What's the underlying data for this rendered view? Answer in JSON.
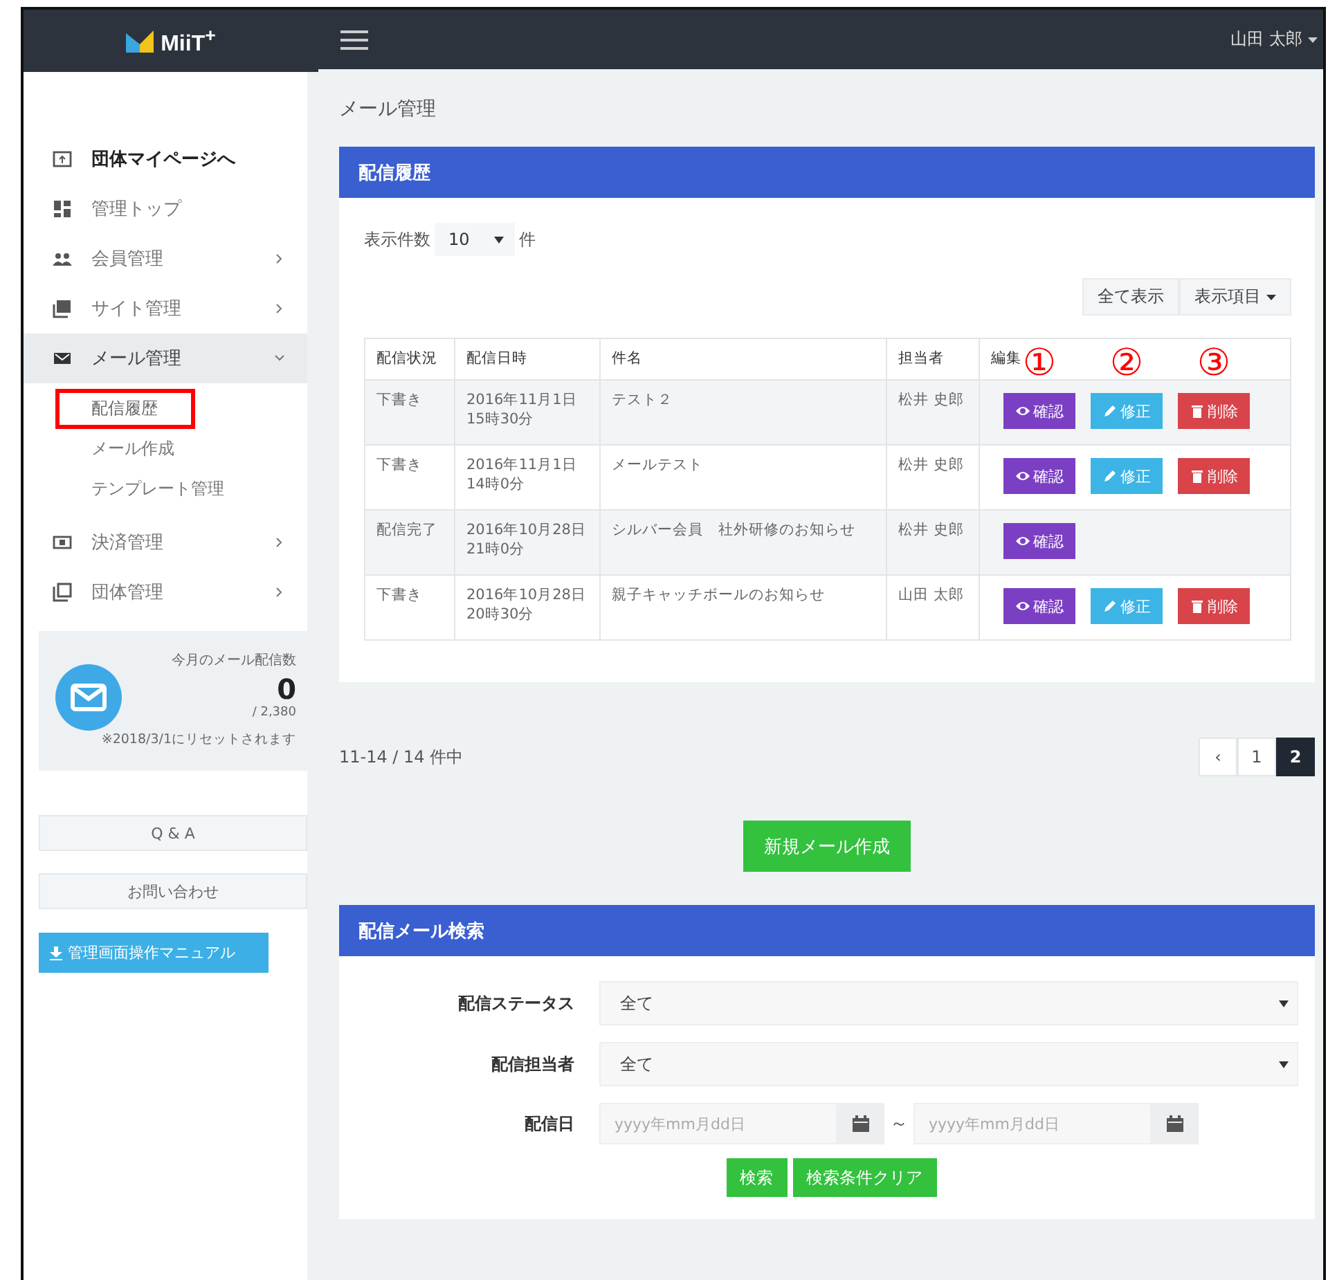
{
  "sidebar": {
    "logo": "MiiT$^{+}$",
    "nav": [
      {
        "label": "団体マイページへ",
        "kind": "external",
        "selected": false
      },
      {
        "label": "管理トップ",
        "kind": "menu",
        "selected": false
      },
      {
        "label": "会員管理",
        "kind": "menu",
        "selected": false,
        "expanded": false
      },
      {
        "label": "サイト管理",
        "kind": "menu",
        "selected": false,
        "expanded": false
      },
      {
        "label": "メール管理",
        "kind": "menu",
        "selected": true,
        "expanded": true,
        "children": [
          {
            "label": "配信履歴",
            "highlighted": true
          },
          {
            "label": "メール作成",
            "highlighted": false
          },
          {
            "label": "テンプレート管理",
            "highlighted": false
          }
        ]
      },
      {
        "label": "決済管理",
        "kind": "menu",
        "selected": false,
        "expanded": false
      },
      {
        "label": "団体管理",
        "kind": "menu",
        "selected": false,
        "expanded": false
      }
    ],
    "stats": {
      "title": "今月のメール配信数",
      "count": "0",
      "limit": "/ 2,380",
      "note": "※2018/3/1にリセットされます"
    },
    "links": [
      "Q & A",
      "お問い合わせ"
    ],
    "manual_button": "管理画面操作マニュアル"
  },
  "topbar": {
    "user": "山田 太郎"
  },
  "page_title": "メール管理",
  "history_panel": {
    "title": "配信履歴",
    "per_page_label": "表示件数",
    "per_page": "10",
    "per_page_unit": "件",
    "tools": [
      "全て表示",
      "表示項目"
    ],
    "columns": [
      "配信状況",
      "配信日時",
      "件名",
      "担当者",
      "編集"
    ],
    "annotations": [
      "①",
      "②",
      "③"
    ],
    "rows": [
      {
        "status": "下書き",
        "date": [
          "2016年11月1日",
          "15時30分"
        ],
        "subject": "テスト２",
        "person": "松井 史郎",
        "actions": [
          {
            "kind": "view",
            "label": "確認"
          },
          {
            "kind": "edit",
            "label": "修正"
          },
          {
            "kind": "delete",
            "label": "削除"
          }
        ]
      },
      {
        "status": "下書き",
        "date": [
          "2016年11月1日",
          "14時0分"
        ],
        "subject": "メールテスト",
        "person": "松井 史郎",
        "actions": [
          {
            "kind": "view",
            "label": "確認"
          },
          {
            "kind": "edit",
            "label": "修正"
          },
          {
            "kind": "delete",
            "label": "削除"
          }
        ]
      },
      {
        "status": "配信完了",
        "date": [
          "2016年10月28日",
          "21時0分"
        ],
        "subject": "シルバー会員　社外研修のお知らせ",
        "person": "松井 史郎",
        "actions": [
          {
            "kind": "view",
            "label": "確認"
          }
        ]
      },
      {
        "status": "下書き",
        "date": [
          "2016年10月28日",
          "20時30分"
        ],
        "subject": "親子キャッチボールのお知らせ",
        "person": "山田 太郎",
        "actions": [
          {
            "kind": "view",
            "label": "確認"
          },
          {
            "kind": "edit",
            "label": "修正"
          },
          {
            "kind": "delete",
            "label": "削除"
          }
        ]
      }
    ]
  },
  "pagination": {
    "summary": "11-14 / 14 件中",
    "prev": "‹",
    "pages": [
      {
        "label": "1",
        "selected": false
      },
      {
        "label": "2",
        "selected": true
      }
    ]
  },
  "new_button": "新規メール作成",
  "search_panel": {
    "title": "配信メール検索",
    "fields": [
      {
        "kind": "select",
        "label": "配信ステータス",
        "value": "全て"
      },
      {
        "kind": "select",
        "label": "配信担当者",
        "value": "全て"
      },
      {
        "kind": "date_range",
        "label": "配信日",
        "from_placeholder": "yyyy年mm月dd日",
        "separator": "～",
        "to_placeholder": "yyyy年mm月dd日"
      }
    ],
    "buttons": [
      "検索",
      "検索条件クリア"
    ]
  }
}
